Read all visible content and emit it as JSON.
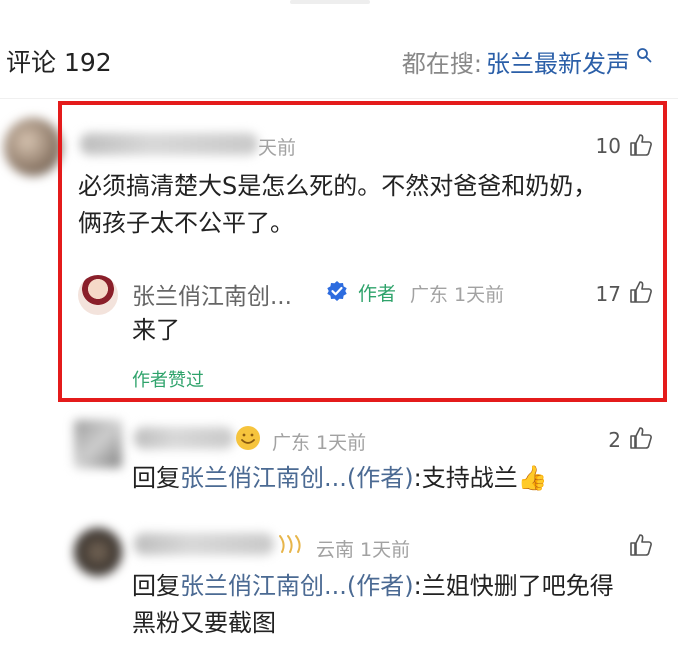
{
  "header": {
    "title": "评论 192",
    "search_prefix": "都在搜:",
    "search_term": "张兰最新发声",
    "search_icon": "search-icon"
  },
  "comment": {
    "time": "天前",
    "likes": "10",
    "text_line1": "必须搞清楚大S是怎么死的。不然对爸爸和奶奶，",
    "text_line2": "俩孩子太不公平了。"
  },
  "author_reply": {
    "name": "张兰俏江南创...",
    "badge": "作者",
    "location_time": "广东 1天前",
    "likes": "17",
    "text": "来了",
    "liked_tag": "作者赞过"
  },
  "replies": [
    {
      "location_time": "广东 1天前",
      "likes": "2",
      "prefix": "回复",
      "author": "张兰俏江南创...(作者)",
      "text": ":支持战兰👍"
    },
    {
      "location_time": "云南 1天前",
      "likes": "",
      "prefix": "回复",
      "author": "张兰俏江南创...(作者)",
      "text_line1": ":兰姐快删了吧免得",
      "text_line2": "黑粉又要截图"
    }
  ],
  "colors": {
    "frame": "#e41b1b",
    "link": "#4b6a93",
    "author_green": "#2fa36b"
  }
}
